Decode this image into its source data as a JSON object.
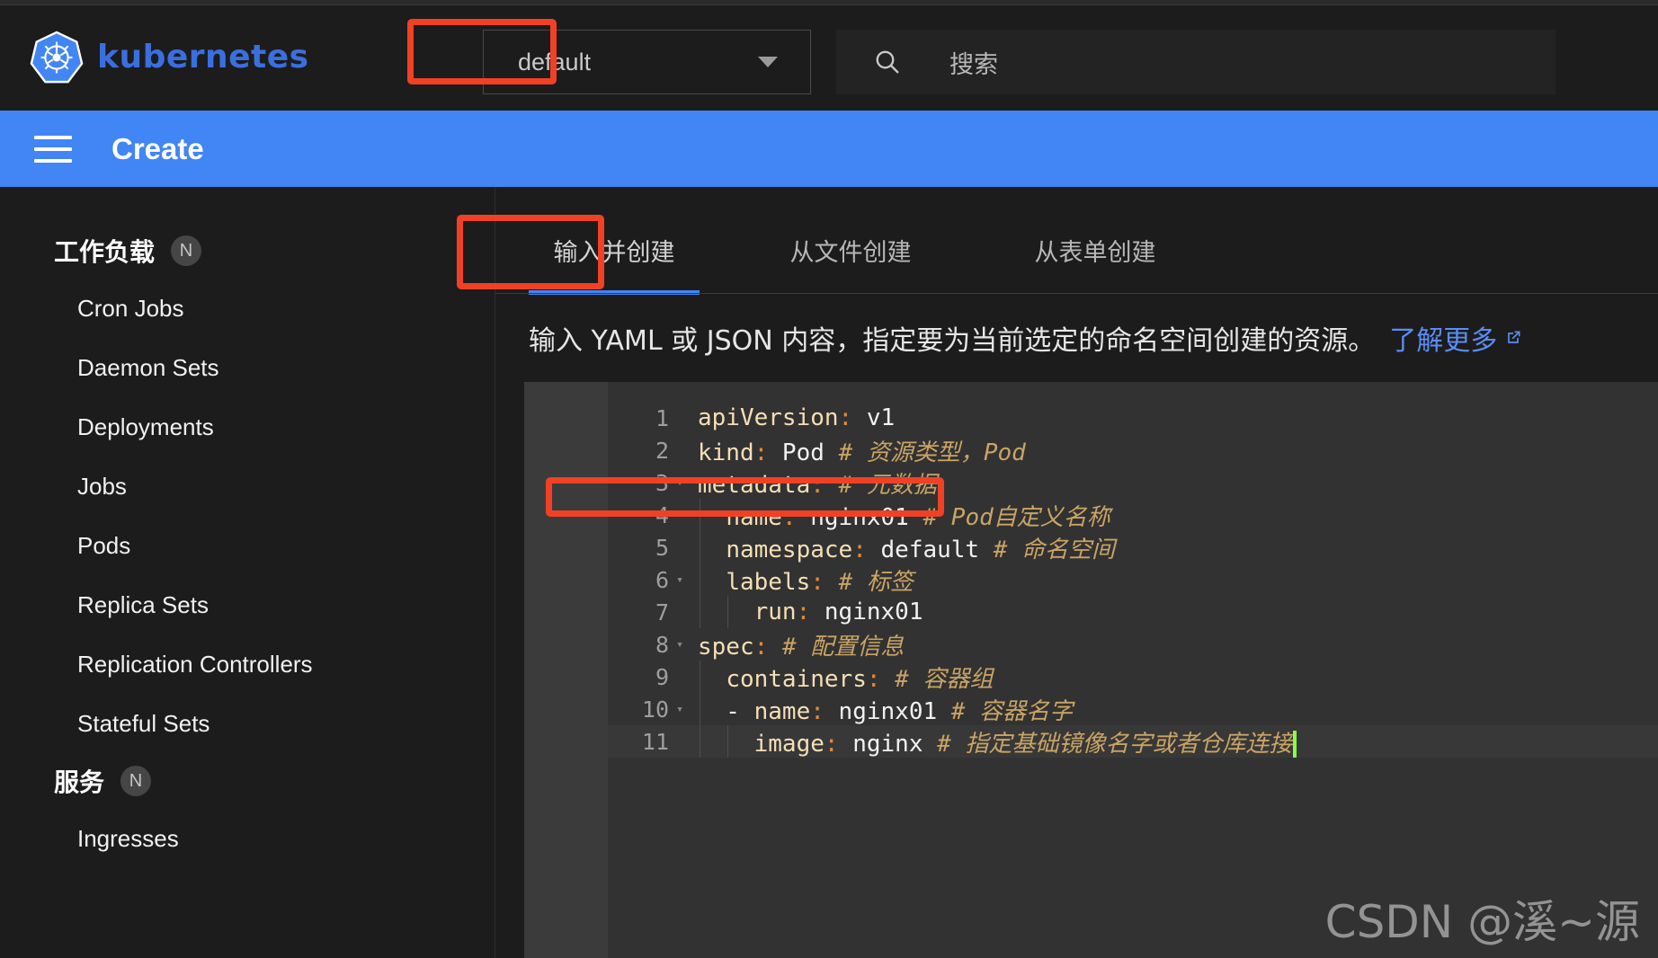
{
  "colors": {
    "brand_blue": "#3a6fe0",
    "action_bar_blue": "#4285f4",
    "annotation_red": "#f04125",
    "editor_bg": "#323232",
    "gutter_bg": "#3b3b3b",
    "link_blue": "#5b8df5",
    "caret_green": "#8aff4a",
    "comment_tan": "#c9a465",
    "key_cream": "#f5dfb6",
    "colon_orange": "#e08a3c"
  },
  "header": {
    "brand_name": "kubernetes",
    "logo_icon": "kubernetes-helm-icon",
    "namespace_select": {
      "value": "default",
      "caret_icon": "chevron-down-icon"
    },
    "search": {
      "icon": "search-icon",
      "placeholder": "搜索",
      "value": ""
    }
  },
  "action_bar": {
    "menu_icon": "hamburger-menu-icon",
    "title": "Create"
  },
  "sidebar": {
    "groups": [
      {
        "title": "工作负载",
        "badge": "N",
        "items": [
          {
            "label": "Cron Jobs"
          },
          {
            "label": "Daemon Sets"
          },
          {
            "label": "Deployments"
          },
          {
            "label": "Jobs"
          },
          {
            "label": "Pods"
          },
          {
            "label": "Replica Sets"
          },
          {
            "label": "Replication Controllers"
          },
          {
            "label": "Stateful Sets"
          }
        ]
      },
      {
        "title": "服务",
        "badge": "N",
        "items": [
          {
            "label": "Ingresses"
          }
        ]
      }
    ]
  },
  "main": {
    "tabs": [
      {
        "label": "输入并创建",
        "active": true
      },
      {
        "label": "从文件创建",
        "active": false
      },
      {
        "label": "从表单创建",
        "active": false
      }
    ],
    "description": "输入 YAML 或 JSON 内容，指定要为当前选定的命名空间创建的资源。",
    "description_link": "了解更多",
    "description_link_icon": "external-link-icon"
  },
  "editor": {
    "active_line": 11,
    "cursor_visible": true,
    "lines": [
      {
        "n": "1",
        "fold": false,
        "indent": 0,
        "tokens": [
          {
            "t": "key",
            "s": "apiVersion"
          },
          {
            "t": "colon",
            "s": ":"
          },
          {
            "t": "val",
            "s": " v1"
          }
        ]
      },
      {
        "n": "2",
        "fold": false,
        "indent": 0,
        "tokens": [
          {
            "t": "key",
            "s": "kind"
          },
          {
            "t": "colon",
            "s": ":"
          },
          {
            "t": "val",
            "s": " Pod "
          },
          {
            "t": "comment",
            "s": "# 资源类型，Pod"
          }
        ]
      },
      {
        "n": "3",
        "fold": true,
        "indent": 0,
        "tokens": [
          {
            "t": "key",
            "s": "metadata"
          },
          {
            "t": "colon",
            "s": ":"
          },
          {
            "t": "val",
            "s": " "
          },
          {
            "t": "comment",
            "s": "# 元数据"
          }
        ]
      },
      {
        "n": "4",
        "fold": false,
        "indent": 1,
        "tokens": [
          {
            "t": "val",
            "s": "  "
          },
          {
            "t": "key",
            "s": "name"
          },
          {
            "t": "colon",
            "s": ":"
          },
          {
            "t": "val",
            "s": " nginx01 "
          },
          {
            "t": "comment",
            "s": "# Pod自定义名称"
          }
        ]
      },
      {
        "n": "5",
        "fold": false,
        "indent": 1,
        "tokens": [
          {
            "t": "val",
            "s": "  "
          },
          {
            "t": "key",
            "s": "namespace"
          },
          {
            "t": "colon",
            "s": ":"
          },
          {
            "t": "val",
            "s": " default "
          },
          {
            "t": "comment",
            "s": "# 命名空间"
          }
        ]
      },
      {
        "n": "6",
        "fold": true,
        "indent": 1,
        "tokens": [
          {
            "t": "val",
            "s": "  "
          },
          {
            "t": "key",
            "s": "labels"
          },
          {
            "t": "colon",
            "s": ":"
          },
          {
            "t": "val",
            "s": " "
          },
          {
            "t": "comment",
            "s": "# 标签"
          }
        ]
      },
      {
        "n": "7",
        "fold": false,
        "indent": 2,
        "tokens": [
          {
            "t": "val",
            "s": "    "
          },
          {
            "t": "key",
            "s": "run"
          },
          {
            "t": "colon",
            "s": ":"
          },
          {
            "t": "val",
            "s": " nginx01"
          }
        ]
      },
      {
        "n": "8",
        "fold": true,
        "indent": 0,
        "tokens": [
          {
            "t": "key",
            "s": "spec"
          },
          {
            "t": "colon",
            "s": ":"
          },
          {
            "t": "val",
            "s": " "
          },
          {
            "t": "comment",
            "s": "# 配置信息"
          }
        ]
      },
      {
        "n": "9",
        "fold": false,
        "indent": 1,
        "tokens": [
          {
            "t": "val",
            "s": "  "
          },
          {
            "t": "key",
            "s": "containers"
          },
          {
            "t": "colon",
            "s": ":"
          },
          {
            "t": "val",
            "s": " "
          },
          {
            "t": "comment",
            "s": "# 容器组"
          }
        ]
      },
      {
        "n": "10",
        "fold": true,
        "indent": 1,
        "tokens": [
          {
            "t": "dash",
            "s": "  - "
          },
          {
            "t": "key",
            "s": "name"
          },
          {
            "t": "colon",
            "s": ":"
          },
          {
            "t": "val",
            "s": " nginx01 "
          },
          {
            "t": "comment",
            "s": "# 容器名字"
          }
        ]
      },
      {
        "n": "11",
        "fold": false,
        "indent": 2,
        "tokens": [
          {
            "t": "val",
            "s": "    "
          },
          {
            "t": "key",
            "s": "image"
          },
          {
            "t": "colon",
            "s": ":"
          },
          {
            "t": "val",
            "s": " nginx "
          },
          {
            "t": "comment",
            "s": "# 指定基础镜像名字或者仓库连接"
          }
        ]
      }
    ]
  },
  "annotations": [
    {
      "name": "namespace-select-highlight"
    },
    {
      "name": "active-tab-highlight"
    },
    {
      "name": "namespace-line-highlight"
    }
  ],
  "watermark": "CSDN @溪~源"
}
